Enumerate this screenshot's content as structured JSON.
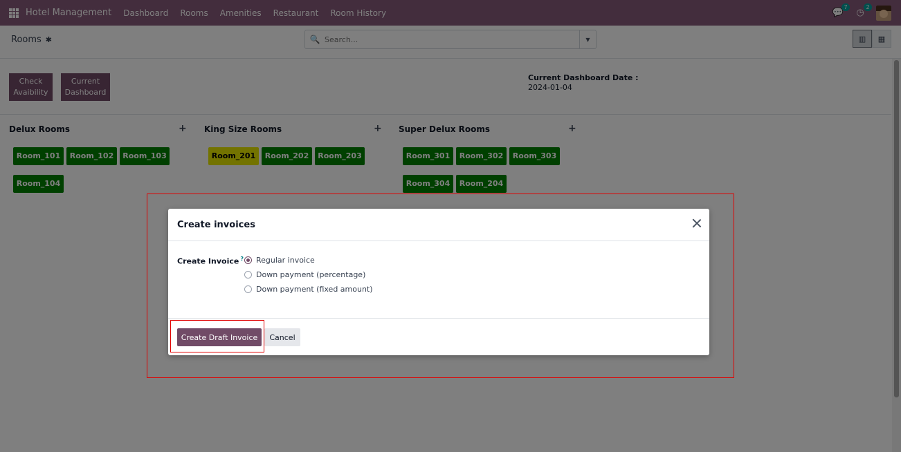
{
  "navbar": {
    "app_title": "Hotel Management",
    "menu": [
      "Dashboard",
      "Rooms",
      "Amenities",
      "Restaurant",
      "Room History"
    ],
    "messages_count": "7",
    "activities_count": "2"
  },
  "control_panel": {
    "breadcrumb": "Rooms",
    "search_placeholder": "Search..."
  },
  "dashboard": {
    "check_availability_label": "Check Avaibility",
    "current_dashboard_label": "Current Dashboard",
    "current_date_label": "Current Dashboard Date :",
    "current_date_value": "2024-01-04",
    "groups": [
      {
        "title": "Delux Rooms",
        "rooms": [
          "Room_101",
          "Room_102",
          "Room_103",
          "Room_104"
        ]
      },
      {
        "title": "King Size Rooms",
        "rooms": [
          "Room_201",
          "Room_202",
          "Room_203"
        ]
      },
      {
        "title": "Super Delux Rooms",
        "rooms": [
          "Room_301",
          "Room_302",
          "Room_303",
          "Room_304",
          "Room_204"
        ]
      }
    ],
    "colors": {
      "available": "#008000",
      "occupied": "#e6e600"
    }
  },
  "dialog": {
    "title": "Create invoices",
    "field_label": "Create Invoice",
    "help_mark": "?",
    "options": [
      "Regular invoice",
      "Down payment (percentage)",
      "Down payment (fixed amount)"
    ],
    "selected_option": "Regular invoice",
    "primary_button": "Create Draft Invoice",
    "secondary_button": "Cancel"
  },
  "theme": {
    "primary": "#714b67",
    "navbar": "#875a7b",
    "highlight": "#e00000"
  }
}
